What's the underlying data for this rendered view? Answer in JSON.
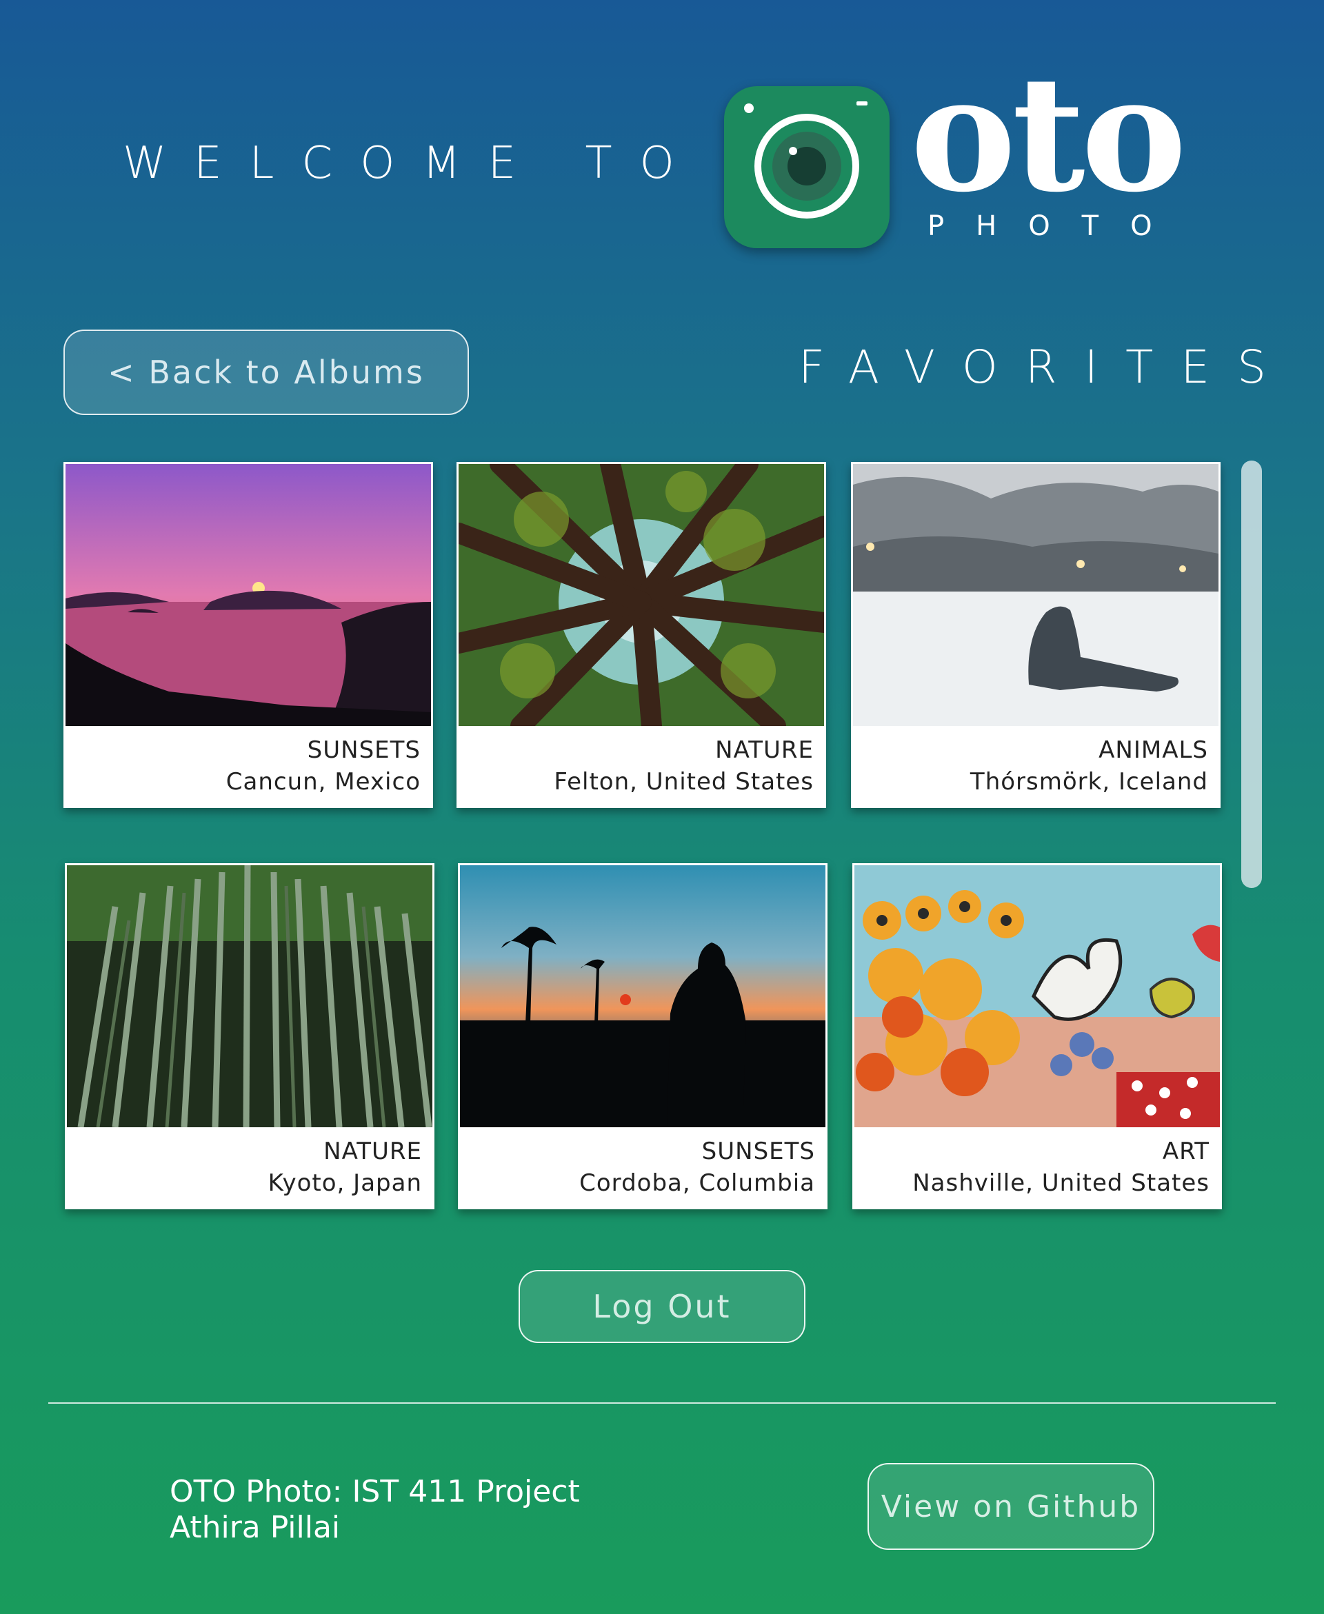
{
  "header": {
    "welcome_text": "WELCOME TO",
    "logo_word": "oto",
    "logo_subtext": "PHOTO",
    "logo_icon": "camera-icon"
  },
  "nav": {
    "back_label": "< Back to Albums",
    "section_title": "FAVORITES"
  },
  "photos": [
    {
      "category": "SUNSETS",
      "location": "Cancun, Mexico"
    },
    {
      "category": "NATURE",
      "location": "Felton, United States"
    },
    {
      "category": "ANIMALS",
      "location": "Thórsmörk, Iceland"
    },
    {
      "category": "NATURE",
      "location": "Kyoto, Japan"
    },
    {
      "category": "SUNSETS",
      "location": "Cordoba, Columbia"
    },
    {
      "category": "ART",
      "location": "Nashville, United States"
    }
  ],
  "actions": {
    "logout_label": "Log Out"
  },
  "footer": {
    "title": "OTO Photo: IST 411 Project",
    "author": "Athira Pillai",
    "github_label": "View on Github"
  },
  "colors": {
    "gradient_top": "#185996",
    "gradient_bottom": "#199b5c",
    "logo_green": "#1c8a5e"
  }
}
